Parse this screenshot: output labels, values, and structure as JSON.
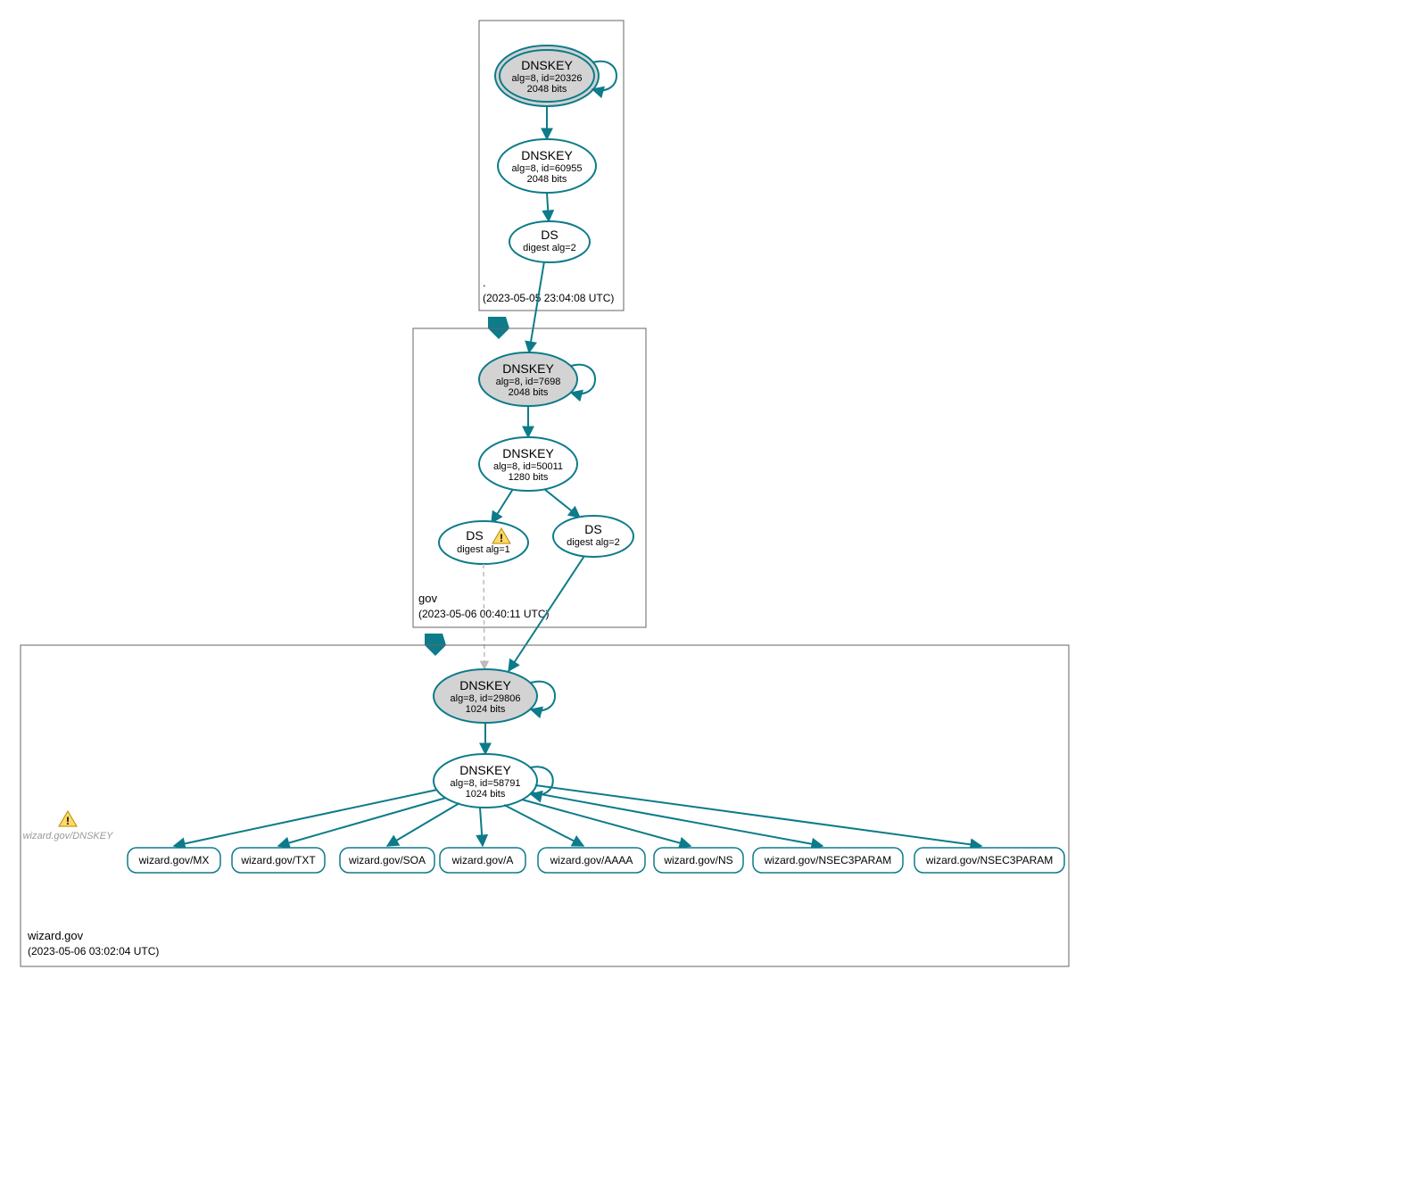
{
  "zones": {
    "root": {
      "label": ".",
      "timestamp": "(2023-05-05 23:04:08 UTC)",
      "nodes": {
        "ksk": {
          "title": "DNSKEY",
          "line1": "alg=8, id=20326",
          "line2": "2048 bits"
        },
        "zsk": {
          "title": "DNSKEY",
          "line1": "alg=8, id=60955",
          "line2": "2048 bits"
        },
        "ds": {
          "title": "DS",
          "line1": "digest alg=2"
        }
      }
    },
    "gov": {
      "label": "gov",
      "timestamp": "(2023-05-06 00:40:11 UTC)",
      "nodes": {
        "ksk": {
          "title": "DNSKEY",
          "line1": "alg=8, id=7698",
          "line2": "2048 bits"
        },
        "zsk": {
          "title": "DNSKEY",
          "line1": "alg=8, id=50011",
          "line2": "1280 bits"
        },
        "ds1": {
          "title": "DS",
          "line1": "digest alg=1",
          "warning": true
        },
        "ds2": {
          "title": "DS",
          "line1": "digest alg=2"
        }
      }
    },
    "wizard": {
      "label": "wizard.gov",
      "timestamp": "(2023-05-06 03:02:04 UTC)",
      "warning_label": "wizard.gov/DNSKEY",
      "nodes": {
        "ksk": {
          "title": "DNSKEY",
          "line1": "alg=8, id=29806",
          "line2": "1024 bits"
        },
        "zsk": {
          "title": "DNSKEY",
          "line1": "alg=8, id=58791",
          "line2": "1024 bits"
        }
      },
      "records": [
        "wizard.gov/MX",
        "wizard.gov/TXT",
        "wizard.gov/SOA",
        "wizard.gov/A",
        "wizard.gov/AAAA",
        "wizard.gov/NS",
        "wizard.gov/NSEC3PARAM",
        "wizard.gov/NSEC3PARAM"
      ]
    }
  }
}
